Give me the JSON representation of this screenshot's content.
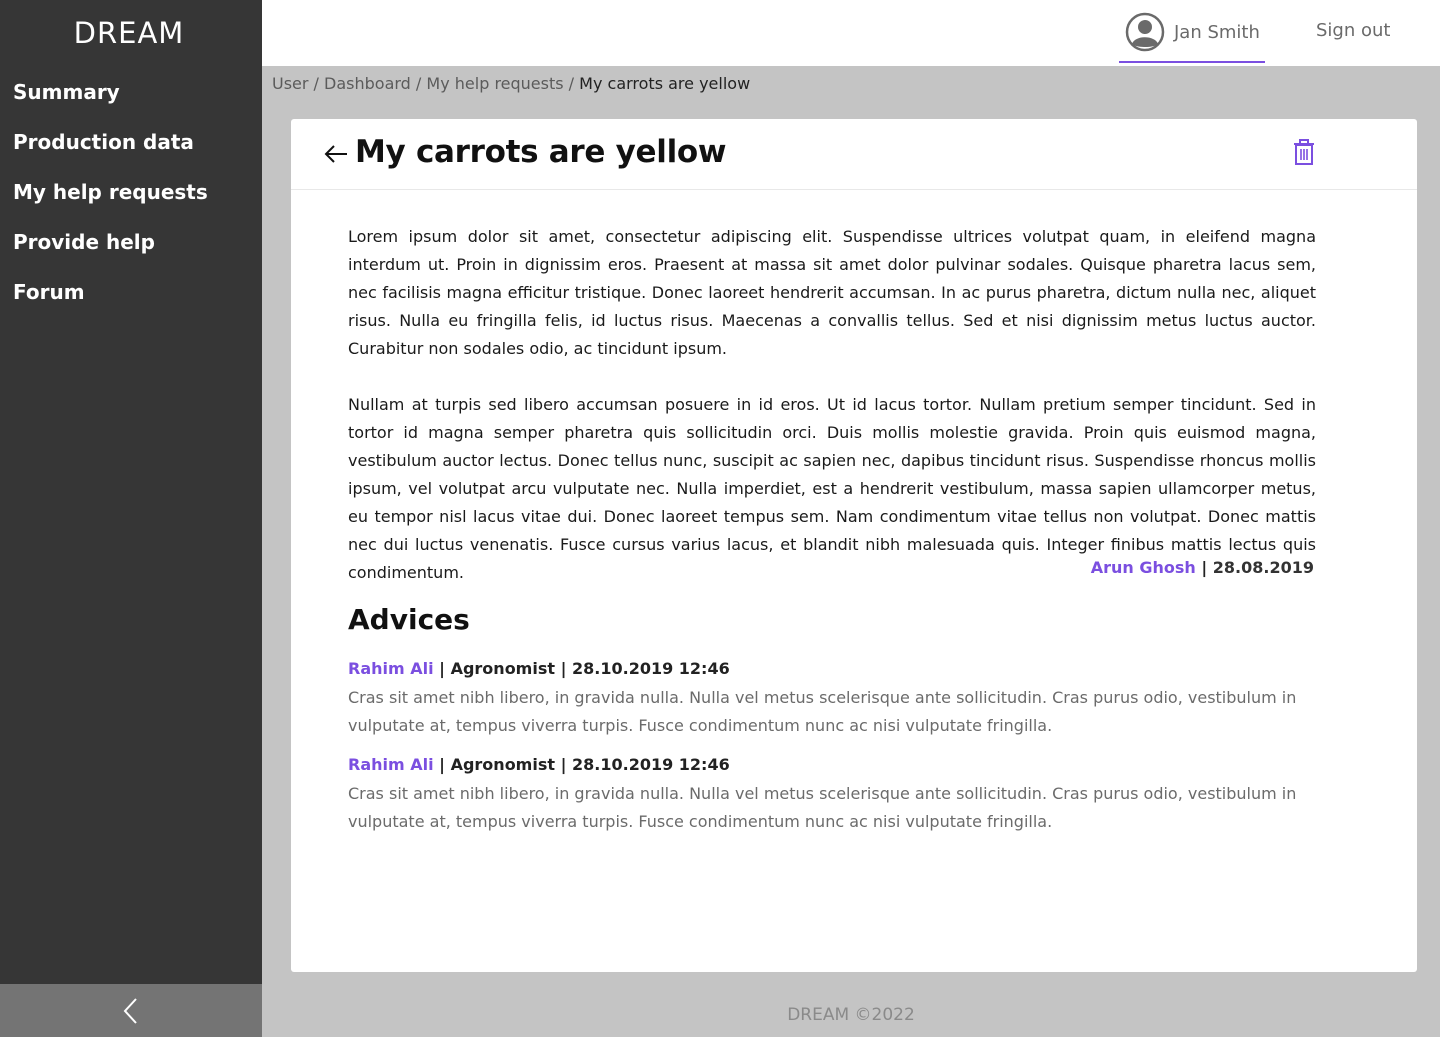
{
  "app": {
    "logo": "DREAM"
  },
  "sidebar": {
    "items": [
      {
        "label": "Summary"
      },
      {
        "label": "Production data"
      },
      {
        "label": "My help requests"
      },
      {
        "label": "Provide help"
      },
      {
        "label": "Forum"
      }
    ],
    "collapse_icon": "chevron-left-icon"
  },
  "header": {
    "user_name": "Jan Smith",
    "sign_out": "Sign out",
    "avatar_icon": "user-circle-icon"
  },
  "breadcrumb": {
    "items": [
      "User",
      "Dashboard",
      "My help requests"
    ],
    "separator": " / ",
    "current": "My carrots are yellow"
  },
  "request": {
    "title": "My carrots are yellow",
    "paragraphs": [
      "Lorem ipsum dolor sit amet, consectetur adipiscing elit. Suspendisse ultrices volutpat quam, in eleifend magna interdum ut. Proin in dignissim eros. Praesent at massa sit amet dolor pulvinar sodales. Quisque pharetra lacus sem, nec facilisis magna efficitur tristique. Donec laoreet hendrerit accumsan. In ac purus pharetra, dictum nulla nec, aliquet risus. Nulla eu fringilla felis, id luctus risus. Maecenas a convallis tellus. Sed et nisi dignissim metus luctus auctor. Curabitur non sodales odio, ac tincidunt ipsum.",
      "Nullam at turpis sed libero accumsan posuere in id eros. Ut id lacus tortor. Nullam pretium semper tincidunt. Sed in tortor id magna semper pharetra quis sollicitudin orci. Duis mollis molestie gravida. Proin quis euismod magna, vestibulum auctor lectus. Donec tellus nunc, suscipit ac sapien nec, dapibus tincidunt risus. Suspendisse rhoncus mollis ipsum, vel volutpat arcu vulputate nec. Nulla imperdiet, est a hendrerit vestibulum, massa sapien ullamcorper metus, eu tempor nisl lacus vitae dui. Donec laoreet tempus sem. Nam condimentum vitae tellus non volutpat. Donec mattis nec dui luctus venenatis. Fusce cursus varius lacus, et blandit nibh malesuada quis. Integer finibus mattis lectus quis condimentum."
    ],
    "author": "Arun Ghosh",
    "separator": " | ",
    "date": "28.08.2019"
  },
  "advices": {
    "title": "Advices",
    "items": [
      {
        "author": "Rahim Ali",
        "role": "Agronomist",
        "datetime": "28.10.2019 12:46",
        "text": "Cras sit amet nibh libero, in gravida nulla. Nulla vel metus scelerisque ante sollicitudin. Cras purus odio, vestibulum in vulputate at, tempus viverra turpis. Fusce condimentum nunc ac nisi vulputate fringilla."
      },
      {
        "author": "Rahim Ali",
        "role": "Agronomist",
        "datetime": "28.10.2019 12:46",
        "text": "Cras sit amet nibh libero, in gravida nulla. Nulla vel metus scelerisque ante sollicitudin. Cras purus odio, vestibulum in vulputate at, tempus viverra turpis. Fusce condimentum nunc ac nisi vulputate fringilla."
      }
    ]
  },
  "footer": {
    "text": "DREAM ©2022"
  },
  "colors": {
    "accent": "#7b4fe0",
    "sidebar": "#363636",
    "background": "#c4c4c4"
  }
}
